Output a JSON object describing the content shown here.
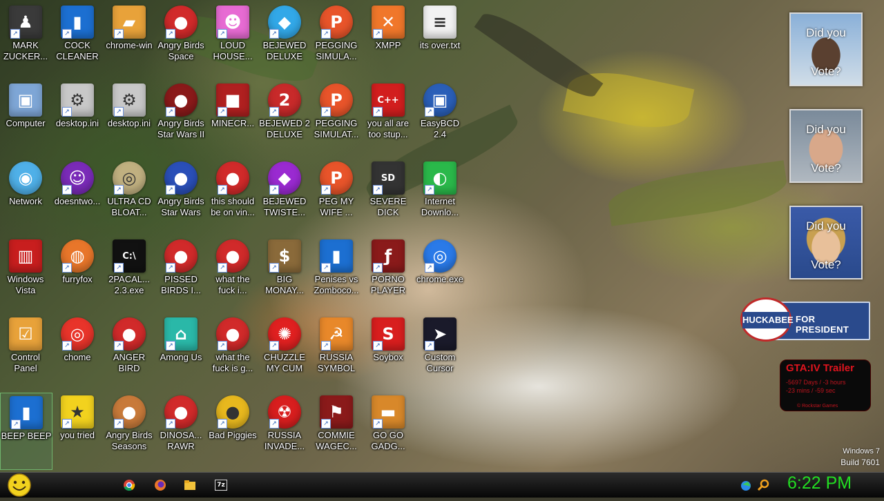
{
  "desktop": {
    "icons": [
      {
        "label": "MARK ZUCKER...",
        "icon": "person-icon",
        "color": "#3a3a3a",
        "glyph": "♟"
      },
      {
        "label": "COCK CLEANER",
        "icon": "phone-icon",
        "color": "#1c6fd1",
        "glyph": "▮"
      },
      {
        "label": "chrome-win",
        "icon": "folder-icon",
        "color": "#e8a23a",
        "glyph": "▰"
      },
      {
        "label": "Angry Birds Space",
        "icon": "angry-bird-icon",
        "color": "#d12a2a",
        "glyph": "●"
      },
      {
        "label": "LOUD HOUSE...",
        "icon": "cartoon-icon",
        "color": "#e76bd3",
        "glyph": "☻"
      },
      {
        "label": "BEJEWED DELUXE",
        "icon": "gem-icon",
        "color": "#32a8e8",
        "glyph": "◆"
      },
      {
        "label": "PEGGING SIMULA...",
        "icon": "peggle-icon",
        "color": "#e8542a",
        "glyph": "P"
      },
      {
        "label": "XMPP",
        "icon": "xampp-icon",
        "color": "#f0772a",
        "glyph": "✕"
      },
      {
        "label": "its over.txt",
        "icon": "text-file-icon",
        "color": "#f2f2f2",
        "glyph": "≡"
      },
      {
        "label": "Computer",
        "icon": "computer-icon",
        "color": "#7ea6d6",
        "glyph": "▣"
      },
      {
        "label": "desktop.ini",
        "icon": "settings-file-icon",
        "color": "#c8c8c8",
        "glyph": "⚙"
      },
      {
        "label": "desktop.ini",
        "icon": "settings-file-icon",
        "color": "#c8c8c8",
        "glyph": "⚙"
      },
      {
        "label": "Angry Birds Star Wars II",
        "icon": "angry-bird-starwars-icon",
        "color": "#8a1a1a",
        "glyph": "●"
      },
      {
        "label": "MINECR...",
        "icon": "minecraft-icon",
        "color": "#b02020",
        "glyph": "■"
      },
      {
        "label": "BEJEWED 2 DELUXE",
        "icon": "gem-icon",
        "color": "#c82a2a",
        "glyph": "2"
      },
      {
        "label": "PEGGING SIMULAT...",
        "icon": "peggle-icon",
        "color": "#e8542a",
        "glyph": "P"
      },
      {
        "label": "you all are too stup...",
        "icon": "dev-cpp-icon",
        "color": "#d21e1e",
        "glyph": "C++"
      },
      {
        "label": "EasyBCD 2.4",
        "icon": "easybcd-icon",
        "color": "#2a5fb8",
        "glyph": "▣"
      },
      {
        "label": "Network",
        "icon": "network-icon",
        "color": "#4fb0e8",
        "glyph": "◉"
      },
      {
        "label": "doesntwo...",
        "icon": "yahoo-messenger-icon",
        "color": "#7a2bb8",
        "glyph": "☺"
      },
      {
        "label": "ULTRA CD BLOAT...",
        "icon": "cd-icon",
        "color": "#c0b080",
        "glyph": "◎"
      },
      {
        "label": "Angry Birds Star Wars",
        "icon": "angry-bird-starwars-icon",
        "color": "#2a4fb8",
        "glyph": "●"
      },
      {
        "label": "this should be on vin...",
        "icon": "angry-bird-icon",
        "color": "#d12a2a",
        "glyph": "●"
      },
      {
        "label": "BEJEWED TWISTE...",
        "icon": "gem-icon",
        "color": "#9a2ad1",
        "glyph": "◆"
      },
      {
        "label": "PEG MY WIFE ...",
        "icon": "peggle-icon",
        "color": "#e8542a",
        "glyph": "P"
      },
      {
        "label": "SEVERE DICK",
        "icon": "sd-card-icon",
        "color": "#333333",
        "glyph": "SD"
      },
      {
        "label": "Internet Downlo...",
        "icon": "download-manager-icon",
        "color": "#2ab84a",
        "glyph": "◐"
      },
      {
        "label": "Windows Vista",
        "icon": "recycle-bin-icon",
        "color": "#c81e1e",
        "glyph": "▥"
      },
      {
        "label": "furryfox",
        "icon": "firefox-icon",
        "color": "#e8762a",
        "glyph": "◍"
      },
      {
        "label": "2PACAL... 2.3.exe",
        "icon": "terminal-icon",
        "color": "#111111",
        "glyph": "C:\\"
      },
      {
        "label": "PISSED BIRDS I...",
        "icon": "angry-bird-icon",
        "color": "#d12a2a",
        "glyph": "●"
      },
      {
        "label": "what the fuck i...",
        "icon": "angry-bird-icon",
        "color": "#d12a2a",
        "glyph": "●"
      },
      {
        "label": "BIG MONAY...",
        "icon": "money-bag-icon",
        "color": "#8a6a3a",
        "glyph": "$"
      },
      {
        "label": "Penises vs Zomboco...",
        "icon": "phone-icon",
        "color": "#1c6fd1",
        "glyph": "▮"
      },
      {
        "label": "PORNO PLAYER",
        "icon": "flash-player-icon",
        "color": "#8a1a1a",
        "glyph": "ƒ"
      },
      {
        "label": "chrome.exe",
        "icon": "chrome-icon",
        "color": "#2a7ae8",
        "glyph": "◎"
      },
      {
        "label": "Control Panel",
        "icon": "control-panel-icon",
        "color": "#e8a23a",
        "glyph": "☑"
      },
      {
        "label": "chome",
        "icon": "chrome-icon",
        "color": "#e8342a",
        "glyph": "◎"
      },
      {
        "label": "ANGER BIRD",
        "icon": "angry-bird-icon",
        "color": "#d12a2a",
        "glyph": "●"
      },
      {
        "label": "Among Us",
        "icon": "among-us-icon",
        "color": "#2ab8a8",
        "glyph": "⌂"
      },
      {
        "label": "what the fuck is g...",
        "icon": "angry-bird-space-icon",
        "color": "#d12a2a",
        "glyph": "●"
      },
      {
        "label": "CHUZZLE MY CUM",
        "icon": "chuzzle-icon",
        "color": "#e02020",
        "glyph": "✺"
      },
      {
        "label": "RUSSIA SYMBOL",
        "icon": "hammer-sickle-icon",
        "color": "#e8882a",
        "glyph": "☭"
      },
      {
        "label": "Soybox",
        "icon": "soybox-icon",
        "color": "#d81e1e",
        "glyph": "S"
      },
      {
        "label": "Custom Cursor",
        "icon": "cursor-icon",
        "color": "#1a1a2a",
        "glyph": "➤"
      },
      {
        "label": "BEEP BEEP",
        "icon": "phone-icon",
        "color": "#1c6fd1",
        "glyph": "▮"
      },
      {
        "label": "you tried",
        "icon": "star-icon",
        "color": "#f2d21e",
        "glyph": "★"
      },
      {
        "label": "Angry Birds Seasons",
        "icon": "angry-bird-seasons-icon",
        "color": "#c87a3a",
        "glyph": "●"
      },
      {
        "label": "DINOSA... RAWR",
        "icon": "angry-bird-icon",
        "color": "#d12a2a",
        "glyph": "●"
      },
      {
        "label": "Bad Piggies",
        "icon": "pig-icon",
        "color": "#e8b81e",
        "glyph": "●"
      },
      {
        "label": "RUSSIA INVADE...",
        "icon": "radiation-icon",
        "color": "#d81e1e",
        "glyph": "☢"
      },
      {
        "label": "COMMIE WAGEC...",
        "icon": "eagle-icon",
        "color": "#8a1a1a",
        "glyph": "⚑"
      },
      {
        "label": "GO GO GADG...",
        "icon": "briefcase-icon",
        "color": "#d8882a",
        "glyph": "▬"
      }
    ]
  },
  "gadgets": {
    "vote": [
      {
        "line1": "Did you",
        "line2": "Vote?",
        "skin": "#5a4030"
      },
      {
        "line1": "Did you",
        "line2": "Vote?",
        "skin": "#d8a88a"
      },
      {
        "line1": "Did you",
        "line2": "Vote?",
        "skin": "#e8c09a"
      }
    ],
    "huckabee": {
      "name": "HUCKABEE",
      "tagline": "FOR PRESIDENT"
    },
    "gta": {
      "title": "GTA:IV  Trailer",
      "line1": "-5697 Days / -3 hours",
      "line2": "-23 mins / -59 sec",
      "footer": "© Rockstar Games"
    }
  },
  "watermark": {
    "os": "Windows 7",
    "build": "Build 7601"
  },
  "taskbar": {
    "start_icon": "smiley-start-icon",
    "pinned": [
      {
        "icon": "chrome-icon"
      },
      {
        "icon": "firefox-icon"
      },
      {
        "icon": "file-explorer-icon"
      },
      {
        "icon": "7zip-icon",
        "text": "7z"
      }
    ],
    "tray": [
      {
        "icon": "network-tray-icon"
      },
      {
        "icon": "search-tray-icon"
      }
    ],
    "clock": "6:22 PM"
  }
}
